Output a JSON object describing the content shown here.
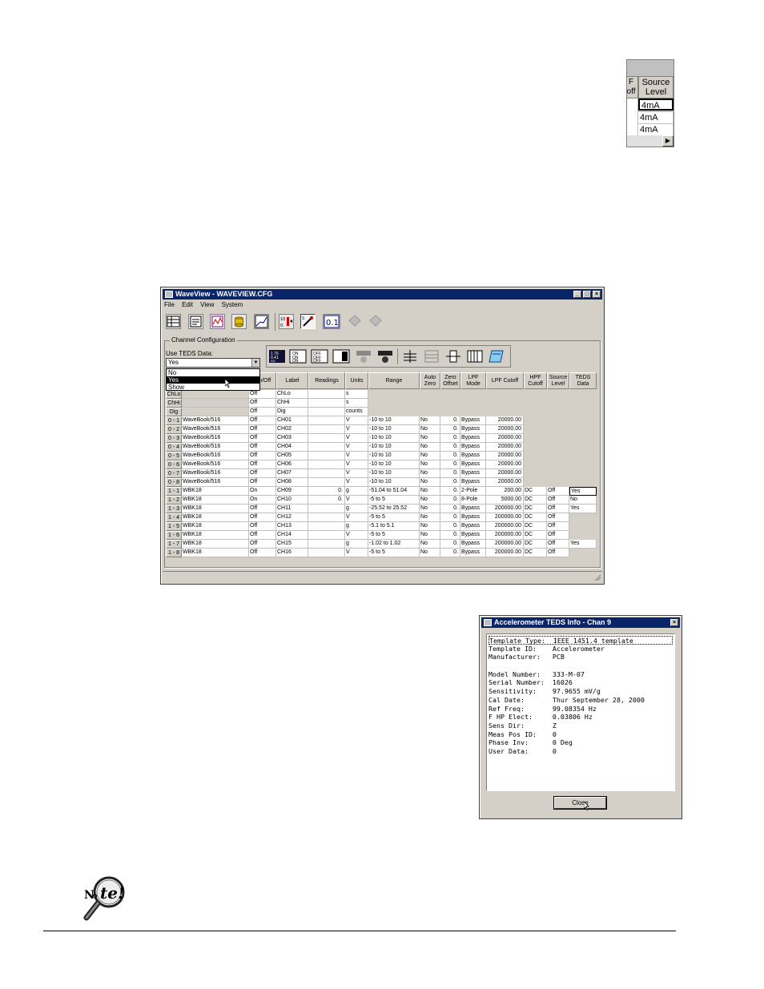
{
  "snippet": {
    "partial_header": "F\noff",
    "header": "Source Level",
    "values": [
      "4mA",
      "4mA",
      "4mA"
    ]
  },
  "window": {
    "title": "WaveView - WAVEVIEW.CFG",
    "menu": [
      "File",
      "Edit",
      "View",
      "System"
    ],
    "group_label": "Channel Configuration",
    "teds_label": "Use TEDS Data:",
    "teds_value": "Yes",
    "teds_options": [
      "No",
      "Yes",
      "Show"
    ],
    "columns": [
      "On/Off",
      "Label",
      "Readings",
      "Units",
      "Range",
      "Auto Zero",
      "Zero Offset",
      "LPF Mode",
      "LPF Cutoff",
      "HPF Cutoff",
      "Source Level",
      "TEDS Data"
    ],
    "rows": [
      {
        "ch": "ChLo",
        "dev": "",
        "onoff": "Off",
        "label": "ChLo",
        "reading": "",
        "units": "s",
        "range": "",
        "az": "",
        "zo": "",
        "lpfm": "",
        "lpfc": "",
        "hpf": "",
        "src": "",
        "teds": ""
      },
      {
        "ch": "ChHi",
        "dev": "",
        "onoff": "Off",
        "label": "ChHi",
        "reading": "",
        "units": "s",
        "range": "",
        "az": "",
        "zo": "",
        "lpfm": "",
        "lpfc": "",
        "hpf": "",
        "src": "",
        "teds": ""
      },
      {
        "ch": "Dig",
        "dev": "",
        "onoff": "Off",
        "label": "Dig",
        "reading": "",
        "units": "counts",
        "range": "",
        "az": "",
        "zo": "",
        "lpfm": "",
        "lpfc": "",
        "hpf": "",
        "src": "",
        "teds": ""
      },
      {
        "ch": "0 - 1",
        "dev": "WaveBook/516",
        "onoff": "Off",
        "label": "CH01",
        "reading": "",
        "units": "V",
        "range": "-10 to 10",
        "az": "No",
        "zo": "0.",
        "lpfm": "Bypass",
        "lpfc": "20000.00",
        "hpf": "",
        "src": "",
        "teds": ""
      },
      {
        "ch": "0 - 2",
        "dev": "WaveBook/516",
        "onoff": "Off",
        "label": "CH02",
        "reading": "",
        "units": "V",
        "range": "-10 to 10",
        "az": "No",
        "zo": "0.",
        "lpfm": "Bypass",
        "lpfc": "20000.00",
        "hpf": "",
        "src": "",
        "teds": ""
      },
      {
        "ch": "0 - 3",
        "dev": "WaveBook/516",
        "onoff": "Off",
        "label": "CH03",
        "reading": "",
        "units": "V",
        "range": "-10 to 10",
        "az": "No",
        "zo": "0.",
        "lpfm": "Bypass",
        "lpfc": "20000.00",
        "hpf": "",
        "src": "",
        "teds": ""
      },
      {
        "ch": "0 - 4",
        "dev": "WaveBook/516",
        "onoff": "Off",
        "label": "CH04",
        "reading": "",
        "units": "V",
        "range": "-10 to 10",
        "az": "No",
        "zo": "0.",
        "lpfm": "Bypass",
        "lpfc": "20000.00",
        "hpf": "",
        "src": "",
        "teds": ""
      },
      {
        "ch": "0 - 5",
        "dev": "WaveBook/516",
        "onoff": "Off",
        "label": "CH05",
        "reading": "",
        "units": "V",
        "range": "-10 to 10",
        "az": "No",
        "zo": "0.",
        "lpfm": "Bypass",
        "lpfc": "20000.00",
        "hpf": "",
        "src": "",
        "teds": ""
      },
      {
        "ch": "0 - 6",
        "dev": "WaveBook/516",
        "onoff": "Off",
        "label": "CH06",
        "reading": "",
        "units": "V",
        "range": "-10 to 10",
        "az": "No",
        "zo": "0.",
        "lpfm": "Bypass",
        "lpfc": "20000.00",
        "hpf": "",
        "src": "",
        "teds": ""
      },
      {
        "ch": "0 - 7",
        "dev": "WaveBook/516",
        "onoff": "Off",
        "label": "CH07",
        "reading": "",
        "units": "V",
        "range": "-10 to 10",
        "az": "No",
        "zo": "0.",
        "lpfm": "Bypass",
        "lpfc": "20000.00",
        "hpf": "",
        "src": "",
        "teds": ""
      },
      {
        "ch": "0 - 8",
        "dev": "WaveBook/516",
        "onoff": "Off",
        "label": "CH08",
        "reading": "",
        "units": "V",
        "range": "-10 to 10",
        "az": "No",
        "zo": "0.",
        "lpfm": "Bypass",
        "lpfc": "20000.00",
        "hpf": "",
        "src": "",
        "teds": ""
      },
      {
        "ch": "1 - 1",
        "dev": "WBK18",
        "onoff": "On",
        "label": "CH09",
        "reading": "0.",
        "units": "g",
        "range": "-51.04 to 51.04",
        "az": "No",
        "zo": "0.",
        "lpfm": "2-Pole",
        "lpfc": "200.00",
        "hpf": "DC",
        "src": "Off",
        "teds": "Yes"
      },
      {
        "ch": "1 - 2",
        "dev": "WBK18",
        "onoff": "On",
        "label": "CH10",
        "reading": "0.",
        "units": "V",
        "range": "-5 to 5",
        "az": "No",
        "zo": "0.",
        "lpfm": "8-Pole",
        "lpfc": "5000.00",
        "hpf": "DC",
        "src": "Off",
        "teds": "No"
      },
      {
        "ch": "1 - 3",
        "dev": "WBK18",
        "onoff": "Off",
        "label": "CH11",
        "reading": "",
        "units": "g",
        "range": "-25.52 to 25.52",
        "az": "No",
        "zo": "0.",
        "lpfm": "Bypass",
        "lpfc": "200000.00",
        "hpf": "DC",
        "src": "Off",
        "teds": "Yes"
      },
      {
        "ch": "1 - 4",
        "dev": "WBK18",
        "onoff": "Off",
        "label": "CH12",
        "reading": "",
        "units": "V",
        "range": "-5 to 5",
        "az": "No",
        "zo": "0.",
        "lpfm": "Bypass",
        "lpfc": "200000.00",
        "hpf": "DC",
        "src": "Off",
        "teds": ""
      },
      {
        "ch": "1 - 5",
        "dev": "WBK18",
        "onoff": "Off",
        "label": "CH13",
        "reading": "",
        "units": "g",
        "range": "-5.1 to 5.1",
        "az": "No",
        "zo": "0.",
        "lpfm": "Bypass",
        "lpfc": "200000.00",
        "hpf": "DC",
        "src": "Off",
        "teds": ""
      },
      {
        "ch": "1 - 6",
        "dev": "WBK18",
        "onoff": "Off",
        "label": "CH14",
        "reading": "",
        "units": "V",
        "range": "-5 to 5",
        "az": "No",
        "zo": "0.",
        "lpfm": "Bypass",
        "lpfc": "200000.00",
        "hpf": "DC",
        "src": "Off",
        "teds": ""
      },
      {
        "ch": "1 - 7",
        "dev": "WBK18",
        "onoff": "Off",
        "label": "CH15",
        "reading": "",
        "units": "g",
        "range": "-1.02 to 1.02",
        "az": "No",
        "zo": "0.",
        "lpfm": "Bypass",
        "lpfc": "200000.00",
        "hpf": "DC",
        "src": "Off",
        "teds": "Yes"
      },
      {
        "ch": "1 - 8",
        "dev": "WBK18",
        "onoff": "Off",
        "label": "CH16",
        "reading": "",
        "units": "V",
        "range": "-5 to 5",
        "az": "No",
        "zo": "0.",
        "lpfm": "Bypass",
        "lpfc": "200000.00",
        "hpf": "DC",
        "src": "Off",
        "teds": ""
      }
    ]
  },
  "dialog": {
    "title": "Accelerometer TEDS Info - Chan 9",
    "lines": [
      "Template Type:  IEEE 1451.4 template",
      "Template ID:    Accelerometer",
      "Manufacturer:   PCB",
      "",
      "Model Number:   333-M-07",
      "Serial Number:  16026",
      "Sensitivity:    97.9655 mV/g",
      "Cal Date:       Thur September 28, 2000",
      "Ref Freq:       99.08354 Hz",
      "F HP Elect:     0.03806 Hz",
      "Sens Dir:       Z",
      "Meas Pos ID:    0",
      "Phase Inv:      0 Deg",
      "User Data:      0"
    ],
    "close_label": "Close"
  },
  "note": {
    "icon": "note-magnifier-icon",
    "label": "Note!"
  },
  "colors": {
    "titlebar": "#0a246a",
    "face": "#d4d0c8"
  }
}
